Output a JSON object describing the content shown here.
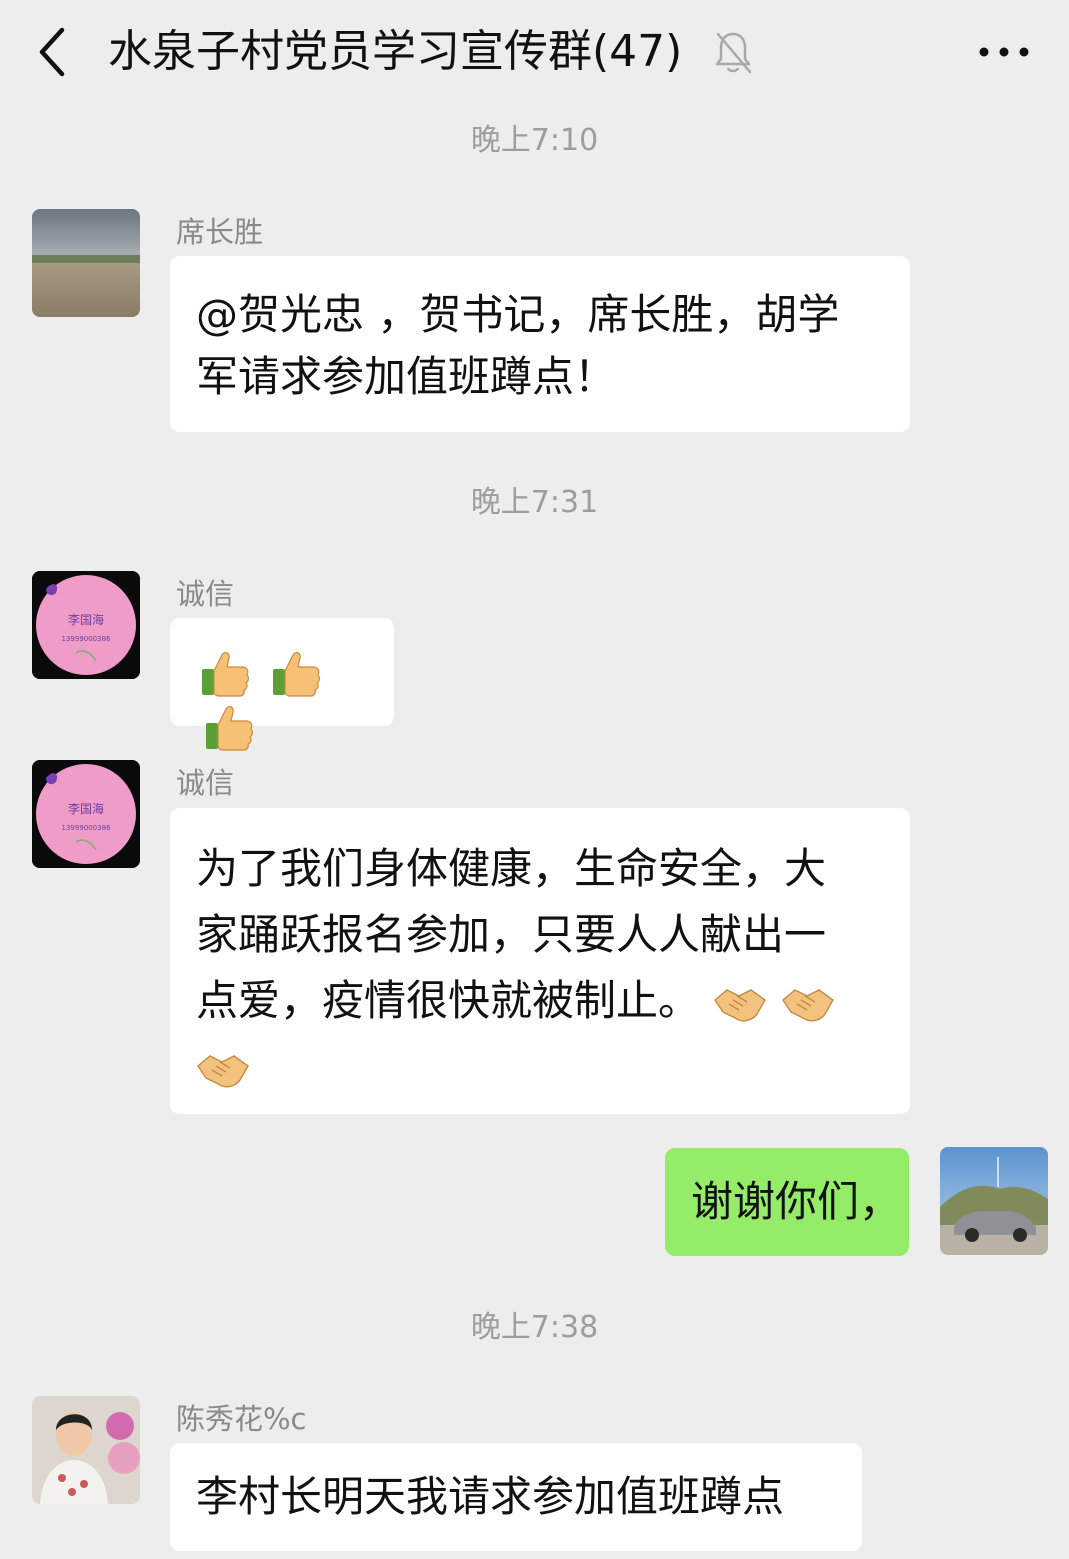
{
  "header": {
    "title": "水泉子村党员学习宣传群(47)",
    "back_icon": "chevron-left-icon",
    "mute_icon": "bell-off-icon",
    "more_icon": "more-dots-icon"
  },
  "messages": [
    {
      "time": "晚上7:10",
      "sender": "席长胜",
      "lines": [
        "@贺光忠 ，贺书记，席长胜，胡学",
        "军请求参加值班蹲点！"
      ]
    },
    {
      "time": "晚上7:31",
      "sender": "诚信",
      "avatar_text": [
        "李国海",
        "13999000386"
      ],
      "emoji": [
        "thumbs-up",
        "thumbs-up",
        "thumbs-up"
      ]
    },
    {
      "sender": "诚信",
      "avatar_text": [
        "李国海",
        "13999000386"
      ],
      "lines": [
        "为了我们身体健康，生命安全，大",
        "家踊跃报名参加，只要人人献出一",
        "点爱，疫情很快就被制止。"
      ],
      "emoji": [
        "handshake",
        "handshake",
        "handshake"
      ]
    },
    {
      "self": true,
      "lines": [
        "谢谢你们，"
      ]
    },
    {
      "time": "晚上7:38",
      "sender": "陈秀花%c",
      "lines": [
        "李村长明天我请求参加值班蹲点"
      ]
    }
  ],
  "colors": {
    "background": "#ededed",
    "bubble_other": "#ffffff",
    "bubble_self": "#95ec69",
    "timestamp": "#9d9d9d",
    "sender": "#8a8a8a"
  }
}
